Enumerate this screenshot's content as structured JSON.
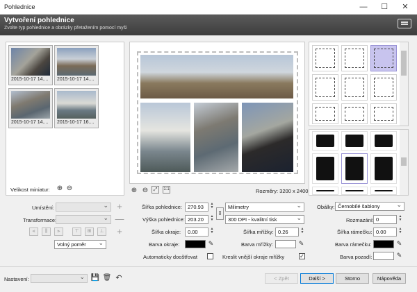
{
  "window": {
    "title": "Pohlednice"
  },
  "header": {
    "title": "Vytvoření pohlednice",
    "subtitle": "Zvolte typ pohlednice a obrázky přetažením pomocí myši"
  },
  "thumbnails": [
    {
      "caption": "2015-10-17 14...."
    },
    {
      "caption": "2015-10-17 14...."
    },
    {
      "caption": "2015-10-17 14...."
    },
    {
      "caption": "2015-10-17 16...."
    }
  ],
  "thumb_size": {
    "label": "Velikost miniatur:"
  },
  "preview": {
    "dimensions": "Rozměry: 3200 x 2400"
  },
  "left_controls": {
    "placement_label": "Umístění:",
    "transform_label": "Transformace:",
    "ratio_value": "Volný poměr"
  },
  "size": {
    "width_label": "Šířka pohlednice:",
    "width_value": "270.93",
    "height_label": "Výška pohlednice:",
    "height_value": "203.20",
    "unit_value": "Milimetry",
    "dpi_value": "300 DPI - kvalitní tisk",
    "border_width_label": "Šířka okraje:",
    "border_width_value": "0.00",
    "grid_width_label": "Šířka mřížky:",
    "grid_width_value": "0.26",
    "border_color_label": "Barva okraje:",
    "grid_color_label": "Barva mřížky:",
    "auto_fit_label": "Automaticky dooštřovat",
    "outer_edges_label": "Kreslit vnější okraje mřížky"
  },
  "frames": {
    "envelope_label": "Obálky:",
    "envelope_value": "Černobílé šablony",
    "blur_label": "Rozmazání:",
    "blur_value": "0",
    "frame_width_label": "Šířka rámečku:",
    "frame_width_value": "0.00",
    "frame_color_label": "Barva rámečku:",
    "bg_color_label": "Barva pozadí:"
  },
  "footer": {
    "settings_label": "Nastavení:",
    "back_label": "< Zpět",
    "next_label": "Další >",
    "cancel_label": "Storno",
    "help_label": "Nápověda"
  },
  "colors": {
    "header_bg": "#4a4a4a",
    "selected_layout": "#c8c4ee",
    "default_button_border": "#0078d7"
  }
}
